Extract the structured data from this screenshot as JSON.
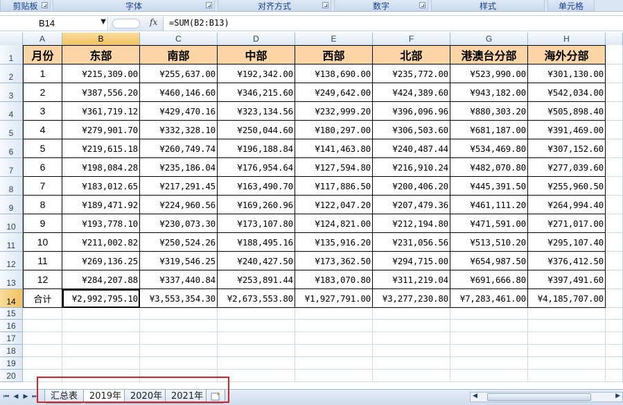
{
  "ribbon": {
    "groups": [
      "剪贴板",
      "字体",
      "对齐方式",
      "数字",
      "样式",
      "单元格"
    ]
  },
  "formula_bar": {
    "name_box": "B14",
    "fx_label": "fx",
    "formula": "=SUM(B2:B13)"
  },
  "columns": [
    "A",
    "B",
    "C",
    "D",
    "E",
    "F",
    "G",
    "H"
  ],
  "rows": [
    "1",
    "2",
    "3",
    "4",
    "5",
    "6",
    "7",
    "8",
    "9",
    "10",
    "11",
    "12",
    "13",
    "14",
    "15",
    "16",
    "17",
    "18",
    "19",
    "20"
  ],
  "table": {
    "headers": [
      "月份",
      "东部",
      "南部",
      "中部",
      "西部",
      "北部",
      "港澳台分部",
      "海外分部"
    ],
    "data": [
      [
        "1",
        "¥215,309.00",
        "¥255,637.00",
        "¥192,342.00",
        "¥138,690.00",
        "¥235,772.00",
        "¥523,990.00",
        "¥301,130.00"
      ],
      [
        "2",
        "¥387,556.20",
        "¥460,146.60",
        "¥346,215.60",
        "¥249,642.00",
        "¥424,389.60",
        "¥943,182.00",
        "¥542,034.00"
      ],
      [
        "3",
        "¥361,719.12",
        "¥429,470.16",
        "¥323,134.56",
        "¥232,999.20",
        "¥396,096.96",
        "¥880,303.20",
        "¥505,898.40"
      ],
      [
        "4",
        "¥279,901.70",
        "¥332,328.10",
        "¥250,044.60",
        "¥180,297.00",
        "¥306,503.60",
        "¥681,187.00",
        "¥391,469.00"
      ],
      [
        "5",
        "¥219,615.18",
        "¥260,749.74",
        "¥196,188.84",
        "¥141,463.80",
        "¥240,487.44",
        "¥534,469.80",
        "¥307,152.60"
      ],
      [
        "6",
        "¥198,084.28",
        "¥235,186.04",
        "¥176,954.64",
        "¥127,594.80",
        "¥216,910.24",
        "¥482,070.80",
        "¥277,039.60"
      ],
      [
        "7",
        "¥183,012.65",
        "¥217,291.45",
        "¥163,490.70",
        "¥117,886.50",
        "¥200,406.20",
        "¥445,391.50",
        "¥255,960.50"
      ],
      [
        "8",
        "¥189,471.92",
        "¥224,960.56",
        "¥169,260.96",
        "¥122,047.20",
        "¥207,479.36",
        "¥461,111.20",
        "¥264,994.40"
      ],
      [
        "9",
        "¥193,778.10",
        "¥230,073.30",
        "¥173,107.80",
        "¥124,821.00",
        "¥212,194.80",
        "¥471,591.00",
        "¥271,017.00"
      ],
      [
        "10",
        "¥211,002.82",
        "¥250,524.26",
        "¥188,495.16",
        "¥135,916.20",
        "¥231,056.56",
        "¥513,510.20",
        "¥295,107.40"
      ],
      [
        "11",
        "¥269,136.25",
        "¥319,546.25",
        "¥240,427.50",
        "¥173,362.50",
        "¥294,715.00",
        "¥654,987.50",
        "¥376,412.50"
      ],
      [
        "12",
        "¥284,207.88",
        "¥337,440.84",
        "¥253,891.44",
        "¥183,070.80",
        "¥311,219.04",
        "¥691,666.80",
        "¥397,491.60"
      ]
    ],
    "total": [
      "合计",
      "¥2,992,795.10",
      "¥3,553,354.30",
      "¥2,673,553.80",
      "¥1,927,791.00",
      "¥3,277,230.80",
      "¥7,283,461.00",
      "¥4,185,707.00"
    ]
  },
  "sheet_tabs": [
    "汇总表",
    "2019年",
    "2020年",
    "2021年"
  ],
  "active_sheet": "2019年",
  "active_cell": "B14",
  "colors": {
    "header_fill": "#fbd5a6",
    "highlight_box": "#e02020",
    "selected_header": "#f1c15f"
  }
}
